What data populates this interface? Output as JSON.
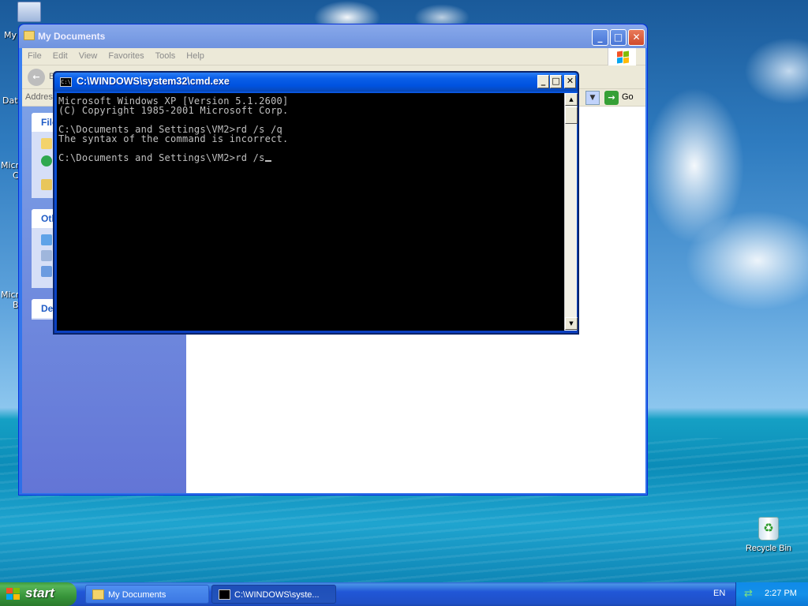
{
  "desktop": {
    "left_icons": [
      {
        "label": "My",
        "name": "my-computer"
      },
      {
        "label": "Dat",
        "name": "data"
      },
      {
        "label": "Micr",
        "name": "microsoft-1"
      },
      {
        "label": "C",
        "name": "microsoft-1-line2"
      },
      {
        "label": "Micr",
        "name": "microsoft-2"
      },
      {
        "label": "B",
        "name": "microsoft-2-line2"
      }
    ],
    "recycle_bin_label": "Recycle Bin"
  },
  "explorer": {
    "title": "My Documents",
    "menu": [
      "File",
      "Edit",
      "View",
      "Favorites",
      "Tools",
      "Help"
    ],
    "back_label": "B",
    "address_label": "Addres",
    "go_label": "Go",
    "task_boxes": [
      {
        "header": "File"
      },
      {
        "header": "Oth"
      },
      {
        "header": "De"
      }
    ],
    "buttons": {
      "minimize": "_",
      "maximize": "□",
      "close": "✕"
    }
  },
  "cmd": {
    "title": "C:\\WINDOWS\\system32\\cmd.exe",
    "icon_text": "C:\\",
    "lines": [
      "Microsoft Windows XP [Version 5.1.2600]",
      "(C) Copyright 1985-2001 Microsoft Corp.",
      "",
      "C:\\Documents and Settings\\VM2>rd /s /q",
      "The syntax of the command is incorrect.",
      "",
      "C:\\Documents and Settings\\VM2>rd /s"
    ],
    "buttons": {
      "minimize": "_",
      "maximize": "□",
      "close": "✕"
    }
  },
  "taskbar": {
    "start_label": "start",
    "items": [
      {
        "label": "My Documents",
        "active": false
      },
      {
        "label": "C:\\WINDOWS\\syste...",
        "active": true
      }
    ],
    "language": "EN",
    "clock": "2:27 PM"
  },
  "colors": {
    "xp_blue": "#0054e3",
    "start_green": "#37943a",
    "console_text": "#c0c0c0",
    "console_bg": "#000000"
  }
}
